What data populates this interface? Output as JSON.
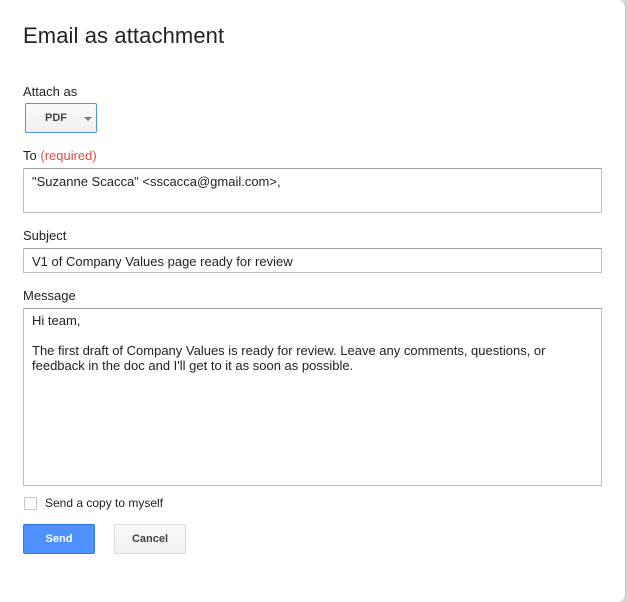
{
  "dialog": {
    "title": "Email as attachment",
    "attach_as": {
      "label": "Attach as",
      "selected": "PDF"
    },
    "to": {
      "label": "To",
      "required": "(required)",
      "value": "\"Suzanne Scacca\" <sscacca@gmail.com>,"
    },
    "subject": {
      "label": "Subject",
      "value": "V1 of Company Values page ready for review"
    },
    "message": {
      "label": "Message",
      "lines": [
        "Hi team,",
        "",
        "The first draft of Company Values is ready for review. Leave any comments, questions, or",
        "feedback in the doc and I'll get to it as soon as possible."
      ]
    },
    "copy_to_self": {
      "label": "Send a copy to myself",
      "checked": false
    },
    "buttons": {
      "send": "Send",
      "cancel": "Cancel"
    }
  },
  "colors": {
    "primary": "#4d90fe",
    "required": "#dd4b39"
  }
}
